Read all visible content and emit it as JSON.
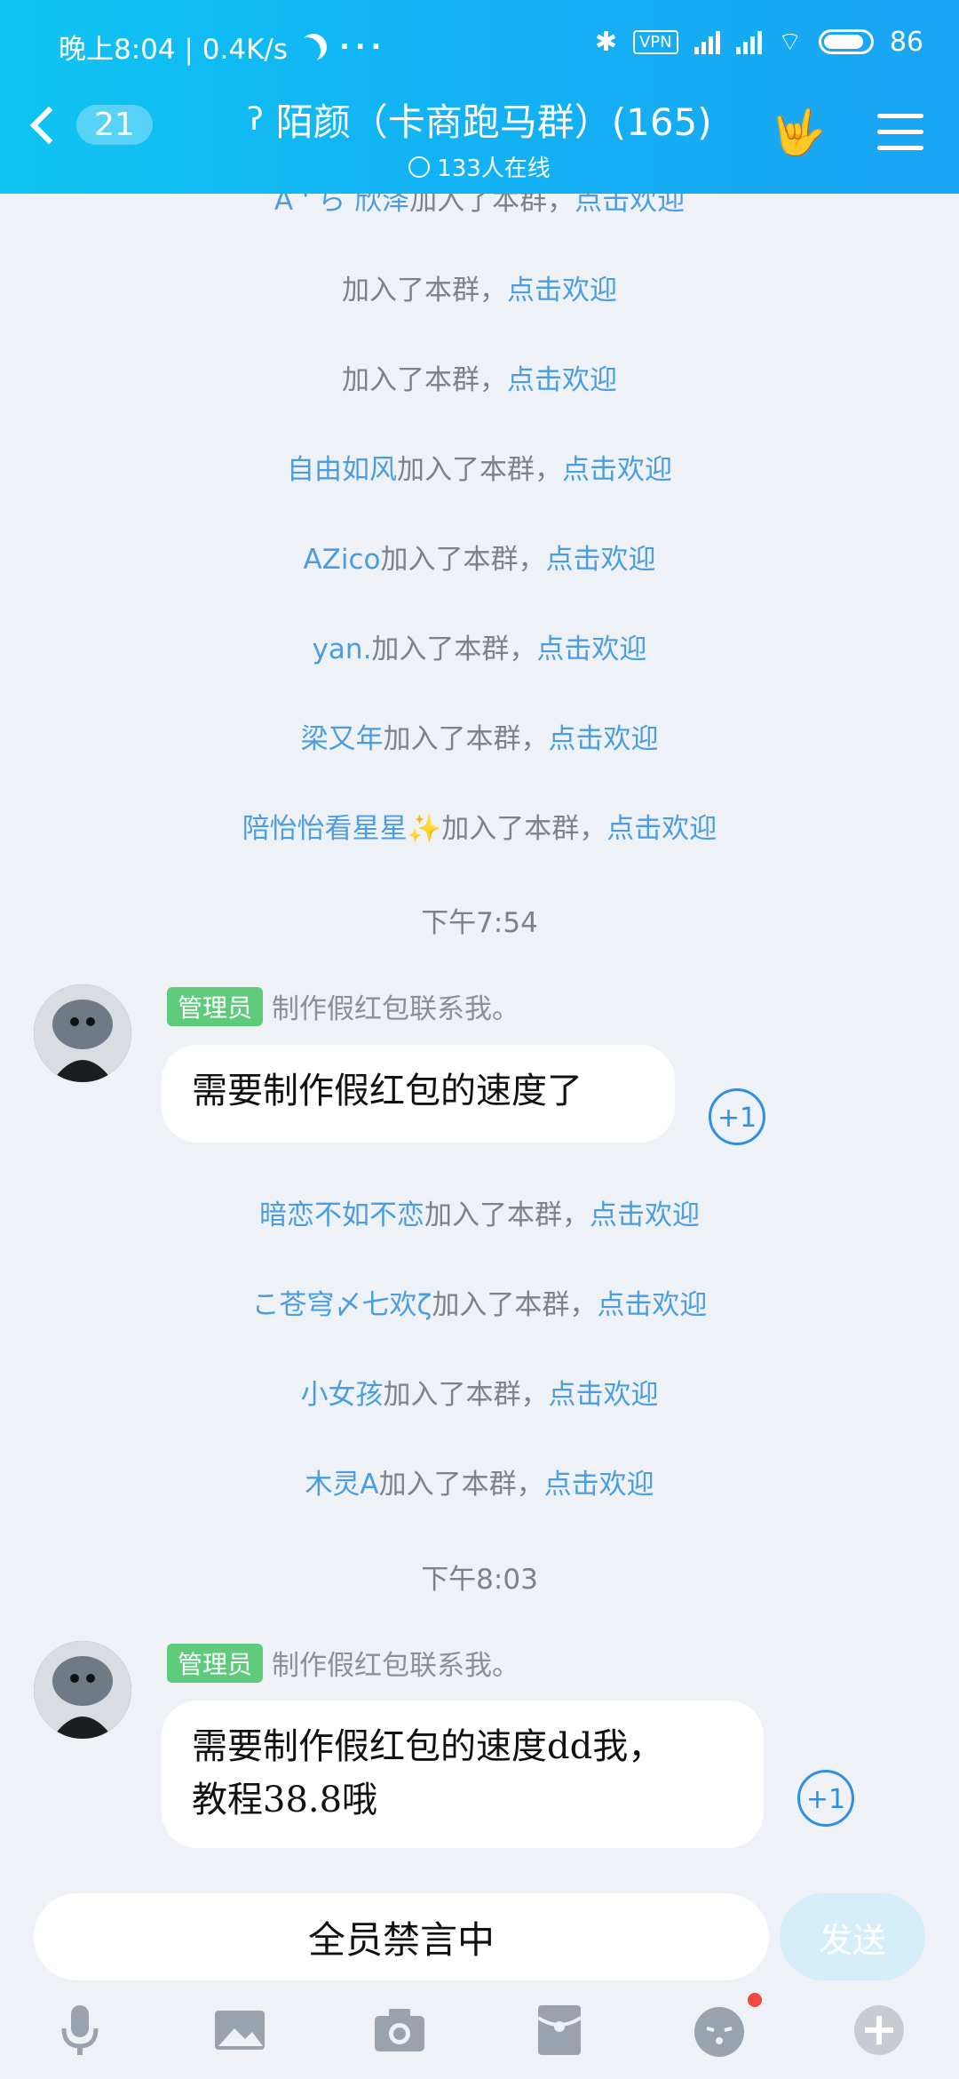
{
  "status_bar": {
    "time_speed": "晚上8:04 | 0.4K/s",
    "more": "···",
    "vpn": "VPN",
    "battery": "86"
  },
  "header": {
    "back_count": "21",
    "title": "陌颜（卡商跑马群）(165)",
    "online": "133人在线"
  },
  "messages": {
    "top_cut": {
      "name": "A ' ら 欣泽",
      "text": "加入了本群，",
      "link": "点击欢迎"
    },
    "sys1": {
      "name": "",
      "text": "加入了本群，",
      "link": "点击欢迎"
    },
    "sys2": {
      "name": "",
      "text": "加入了本群，",
      "link": "点击欢迎"
    },
    "sys3": {
      "name": "自由如风",
      "text": "加入了本群，",
      "link": "点击欢迎"
    },
    "sys4": {
      "name": "AZico",
      "text": "加入了本群，",
      "link": "点击欢迎"
    },
    "sys5": {
      "name": "yan.",
      "text": "加入了本群，",
      "link": "点击欢迎"
    },
    "sys6": {
      "name": "梁又年",
      "text": "加入了本群，",
      "link": "点击欢迎"
    },
    "sys7": {
      "name": "陪怡怡看星星✨",
      "text": "加入了本群，",
      "link": "点击欢迎"
    },
    "time1": "下午7:54",
    "msg1": {
      "role": "管理员",
      "sender": "制作假红包联系我。",
      "text": "需要制作假红包的速度了",
      "plus": "+1"
    },
    "sys8": {
      "name": "暗恋不如不恋",
      "text": "加入了本群，",
      "link": "点击欢迎"
    },
    "sys9": {
      "name": "こ苍穹〆七欢ζ",
      "text": "加入了本群，",
      "link": "点击欢迎"
    },
    "sys10": {
      "name": "小女孩",
      "text": "加入了本群，",
      "link": "点击欢迎"
    },
    "sys11": {
      "name": "木灵A",
      "text": "加入了本群，",
      "link": "点击欢迎"
    },
    "time2": "下午8:03",
    "msg2": {
      "role": "管理员",
      "sender": "制作假红包联系我。",
      "line1": "需要制作假红包的速度dd我，",
      "line2": "教程38.8哦",
      "plus": "+1"
    }
  },
  "input": {
    "value": "全员禁言中",
    "send_label": "发送"
  },
  "toolbar": [
    "mic-icon",
    "image-icon",
    "camera-icon",
    "redpacket-icon",
    "emoji-icon",
    "plus-icon"
  ]
}
